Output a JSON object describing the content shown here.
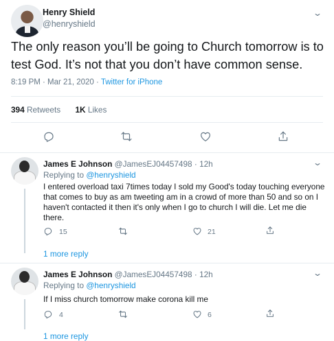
{
  "main_tweet": {
    "author_name": "Henry Shield",
    "author_handle": "@henryshield",
    "text": "The only reason you’ll be going to Church tomorrow is to test God. It’s not that you don’t have common sense.",
    "time": "8:19 PM · Mar 21, 2020 · ",
    "source": "Twitter for iPhone",
    "retweets_count": "394",
    "retweets_label": "Retweets",
    "likes_count": "1K",
    "likes_label": "Likes"
  },
  "replies": [
    {
      "author_name": "James E Johnson",
      "author_handle": "@JamesEJ04457498",
      "time": "· 12h",
      "replying_prefix": "Replying to",
      "replying_to": "@henryshield",
      "text": "I entered overload taxi 7times today I sold my Good's today  touching everyone that comes to buy as am tweeting am in a crowd of more than 50 and so on I haven't contacted it then it's only when I go to church I will die. Let me die there.",
      "reply_count": "15",
      "like_count": "21",
      "more_replies": "1 more reply"
    },
    {
      "author_name": "James E Johnson",
      "author_handle": "@JamesEJ04457498",
      "time": "· 12h",
      "replying_prefix": "Replying to",
      "replying_to": "@henryshield",
      "text": "If I miss church tomorrow make corona kill me",
      "reply_count": "4",
      "like_count": "6",
      "more_replies": "1 more reply"
    }
  ],
  "icons": {
    "reply": "reply-icon",
    "retweet": "retweet-icon",
    "like": "heart-icon",
    "share": "share-icon",
    "menu": "chevron-down-icon"
  },
  "colors": {
    "link": "#1b95e0",
    "secondary_text": "#657786",
    "primary_text": "#14171a",
    "border": "#e6ecf0"
  }
}
